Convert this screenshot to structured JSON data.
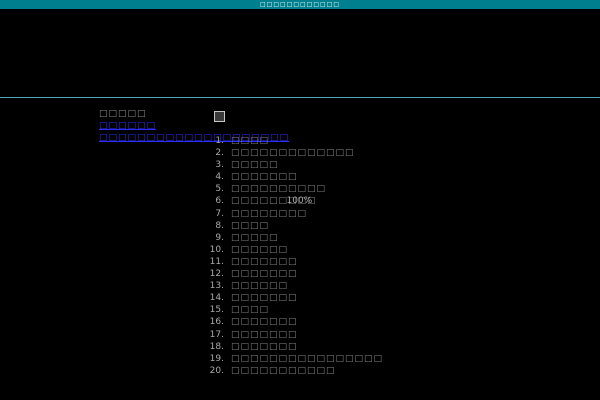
{
  "window": {
    "title": "□□□□□□□□□□□□"
  },
  "sidebar": {
    "heading": "□□□□□",
    "links": [
      "□□□□□□",
      "□□□□□□□□□□□□□□□□□□□□"
    ]
  },
  "list": {
    "items": [
      {
        "num": "1.",
        "label": "□□□□"
      },
      {
        "num": "2.",
        "label": "□□□□□□□□□□□□□"
      },
      {
        "num": "3.",
        "label": "□□□□□"
      },
      {
        "num": "4.",
        "label": "□□□□□□□"
      },
      {
        "num": "5.",
        "label": "□□□□□□□□□□"
      },
      {
        "num": "6.",
        "label": "□□□□□□□□□",
        "extra": "100%"
      },
      {
        "num": "7.",
        "label": "□□□□□□□□"
      },
      {
        "num": "8.",
        "label": "□□□□"
      },
      {
        "num": "9.",
        "label": "□□□□□"
      },
      {
        "num": "10.",
        "label": "□□□□□□"
      },
      {
        "num": "11.",
        "label": "□□□□□□□"
      },
      {
        "num": "12.",
        "label": "□□□□□□□"
      },
      {
        "num": "13.",
        "label": "□□□□□□"
      },
      {
        "num": "14.",
        "label": "□□□□□□□"
      },
      {
        "num": "15.",
        "label": "□□□□"
      },
      {
        "num": "16.",
        "label": "□□□□□□□"
      },
      {
        "num": "17.",
        "label": "□□□□□□□"
      },
      {
        "num": "18.",
        "label": "□□□□□□□"
      },
      {
        "num": "19.",
        "label": "□□□□□□□□□□□□□□□□"
      },
      {
        "num": "20.",
        "label": "□□□□□□□□□□□"
      }
    ]
  },
  "colors": {
    "titlebar": "#00808f",
    "divider": "#4fa6b3",
    "link": "#2e2eff",
    "background": "#000000"
  }
}
